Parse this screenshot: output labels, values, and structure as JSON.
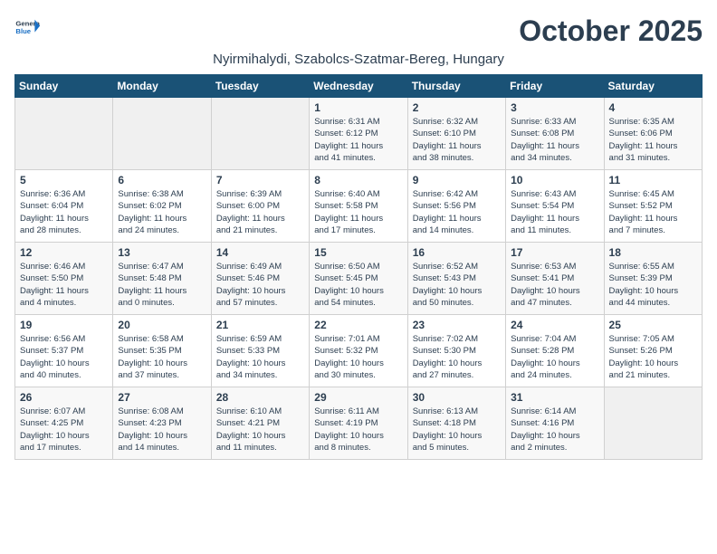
{
  "header": {
    "logo_general": "General",
    "logo_blue": "Blue",
    "month_title": "October 2025",
    "subtitle": "Nyirmihalydi, Szabolcs-Szatmar-Bereg, Hungary"
  },
  "weekdays": [
    "Sunday",
    "Monday",
    "Tuesday",
    "Wednesday",
    "Thursday",
    "Friday",
    "Saturday"
  ],
  "weeks": [
    [
      {
        "day": "",
        "info": ""
      },
      {
        "day": "",
        "info": ""
      },
      {
        "day": "",
        "info": ""
      },
      {
        "day": "1",
        "info": "Sunrise: 6:31 AM\nSunset: 6:12 PM\nDaylight: 11 hours\nand 41 minutes."
      },
      {
        "day": "2",
        "info": "Sunrise: 6:32 AM\nSunset: 6:10 PM\nDaylight: 11 hours\nand 38 minutes."
      },
      {
        "day": "3",
        "info": "Sunrise: 6:33 AM\nSunset: 6:08 PM\nDaylight: 11 hours\nand 34 minutes."
      },
      {
        "day": "4",
        "info": "Sunrise: 6:35 AM\nSunset: 6:06 PM\nDaylight: 11 hours\nand 31 minutes."
      }
    ],
    [
      {
        "day": "5",
        "info": "Sunrise: 6:36 AM\nSunset: 6:04 PM\nDaylight: 11 hours\nand 28 minutes."
      },
      {
        "day": "6",
        "info": "Sunrise: 6:38 AM\nSunset: 6:02 PM\nDaylight: 11 hours\nand 24 minutes."
      },
      {
        "day": "7",
        "info": "Sunrise: 6:39 AM\nSunset: 6:00 PM\nDaylight: 11 hours\nand 21 minutes."
      },
      {
        "day": "8",
        "info": "Sunrise: 6:40 AM\nSunset: 5:58 PM\nDaylight: 11 hours\nand 17 minutes."
      },
      {
        "day": "9",
        "info": "Sunrise: 6:42 AM\nSunset: 5:56 PM\nDaylight: 11 hours\nand 14 minutes."
      },
      {
        "day": "10",
        "info": "Sunrise: 6:43 AM\nSunset: 5:54 PM\nDaylight: 11 hours\nand 11 minutes."
      },
      {
        "day": "11",
        "info": "Sunrise: 6:45 AM\nSunset: 5:52 PM\nDaylight: 11 hours\nand 7 minutes."
      }
    ],
    [
      {
        "day": "12",
        "info": "Sunrise: 6:46 AM\nSunset: 5:50 PM\nDaylight: 11 hours\nand 4 minutes."
      },
      {
        "day": "13",
        "info": "Sunrise: 6:47 AM\nSunset: 5:48 PM\nDaylight: 11 hours\nand 0 minutes."
      },
      {
        "day": "14",
        "info": "Sunrise: 6:49 AM\nSunset: 5:46 PM\nDaylight: 10 hours\nand 57 minutes."
      },
      {
        "day": "15",
        "info": "Sunrise: 6:50 AM\nSunset: 5:45 PM\nDaylight: 10 hours\nand 54 minutes."
      },
      {
        "day": "16",
        "info": "Sunrise: 6:52 AM\nSunset: 5:43 PM\nDaylight: 10 hours\nand 50 minutes."
      },
      {
        "day": "17",
        "info": "Sunrise: 6:53 AM\nSunset: 5:41 PM\nDaylight: 10 hours\nand 47 minutes."
      },
      {
        "day": "18",
        "info": "Sunrise: 6:55 AM\nSunset: 5:39 PM\nDaylight: 10 hours\nand 44 minutes."
      }
    ],
    [
      {
        "day": "19",
        "info": "Sunrise: 6:56 AM\nSunset: 5:37 PM\nDaylight: 10 hours\nand 40 minutes."
      },
      {
        "day": "20",
        "info": "Sunrise: 6:58 AM\nSunset: 5:35 PM\nDaylight: 10 hours\nand 37 minutes."
      },
      {
        "day": "21",
        "info": "Sunrise: 6:59 AM\nSunset: 5:33 PM\nDaylight: 10 hours\nand 34 minutes."
      },
      {
        "day": "22",
        "info": "Sunrise: 7:01 AM\nSunset: 5:32 PM\nDaylight: 10 hours\nand 30 minutes."
      },
      {
        "day": "23",
        "info": "Sunrise: 7:02 AM\nSunset: 5:30 PM\nDaylight: 10 hours\nand 27 minutes."
      },
      {
        "day": "24",
        "info": "Sunrise: 7:04 AM\nSunset: 5:28 PM\nDaylight: 10 hours\nand 24 minutes."
      },
      {
        "day": "25",
        "info": "Sunrise: 7:05 AM\nSunset: 5:26 PM\nDaylight: 10 hours\nand 21 minutes."
      }
    ],
    [
      {
        "day": "26",
        "info": "Sunrise: 6:07 AM\nSunset: 4:25 PM\nDaylight: 10 hours\nand 17 minutes."
      },
      {
        "day": "27",
        "info": "Sunrise: 6:08 AM\nSunset: 4:23 PM\nDaylight: 10 hours\nand 14 minutes."
      },
      {
        "day": "28",
        "info": "Sunrise: 6:10 AM\nSunset: 4:21 PM\nDaylight: 10 hours\nand 11 minutes."
      },
      {
        "day": "29",
        "info": "Sunrise: 6:11 AM\nSunset: 4:19 PM\nDaylight: 10 hours\nand 8 minutes."
      },
      {
        "day": "30",
        "info": "Sunrise: 6:13 AM\nSunset: 4:18 PM\nDaylight: 10 hours\nand 5 minutes."
      },
      {
        "day": "31",
        "info": "Sunrise: 6:14 AM\nSunset: 4:16 PM\nDaylight: 10 hours\nand 2 minutes."
      },
      {
        "day": "",
        "info": ""
      }
    ]
  ]
}
